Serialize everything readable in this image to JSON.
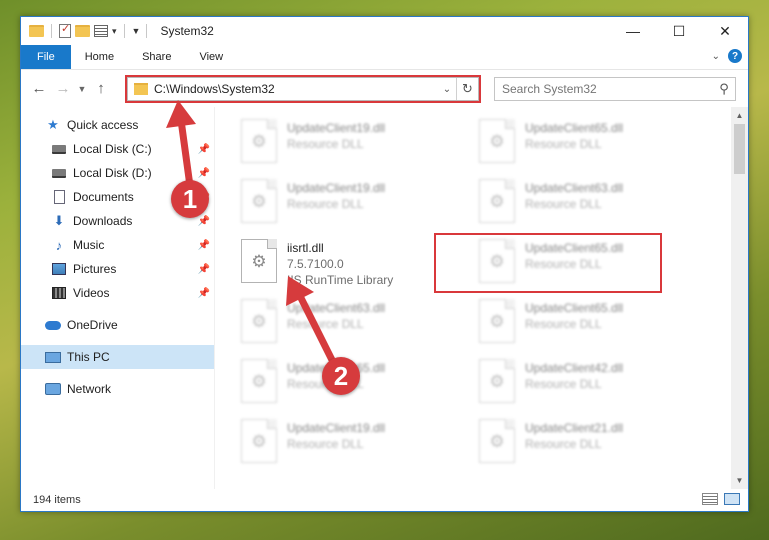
{
  "window": {
    "title": "System32",
    "controls": {
      "minimize": "—",
      "maximize": "☐",
      "close": "✕"
    }
  },
  "ribbon": {
    "tabs": [
      {
        "label": "File"
      },
      {
        "label": "Share"
      },
      {
        "label": "View"
      }
    ],
    "home_label": "Home"
  },
  "nav": {
    "address_path": "C:\\Windows\\System32",
    "search_placeholder": "Search System32"
  },
  "sidebar": {
    "items": [
      {
        "label": "Quick access",
        "icon": "star-icon"
      },
      {
        "label": "Local Disk (C:)",
        "icon": "disk-icon",
        "pinned": true
      },
      {
        "label": "Local Disk (D:)",
        "icon": "disk-icon",
        "pinned": true
      },
      {
        "label": "Documents",
        "icon": "documents-icon",
        "pinned": true
      },
      {
        "label": "Downloads",
        "icon": "downloads-icon",
        "pinned": true
      },
      {
        "label": "Music",
        "icon": "music-icon",
        "pinned": true
      },
      {
        "label": "Pictures",
        "icon": "pictures-icon",
        "pinned": true
      },
      {
        "label": "Videos",
        "icon": "videos-icon",
        "pinned": true
      },
      {
        "label": "OneDrive",
        "icon": "onedrive-icon"
      },
      {
        "label": "This PC",
        "icon": "pc-icon",
        "selected": true
      },
      {
        "label": "Network",
        "icon": "network-icon"
      }
    ]
  },
  "files": [
    {
      "name": "UpdateClient19.dll",
      "type": "Resource DLL"
    },
    {
      "name": "UpdateClient65.dll",
      "type": "Resource DLL"
    },
    {
      "name": "UpdateClient19.dll",
      "type": "Resource DLL"
    },
    {
      "name": "UpdateClient63.dll",
      "type": "Resource DLL"
    },
    {
      "name": "iisrtl.dll",
      "version": "7.5.7100.0",
      "type": "IIS RunTime Library",
      "highlighted": true
    },
    {
      "name": "UpdateClient65.dll",
      "type": "Resource DLL"
    },
    {
      "name": "UpdateClient63.dll",
      "type": "Resource DLL"
    },
    {
      "name": "UpdateClient65.dll",
      "type": "Resource DLL"
    },
    {
      "name": "UpdateClient65.dll",
      "type": "Resource DLL"
    },
    {
      "name": "UpdateClient42.dll",
      "type": "Resource DLL"
    },
    {
      "name": "UpdateClient19.dll",
      "type": "Resource DLL"
    },
    {
      "name": "UpdateClient21.dll",
      "type": "Resource DLL"
    }
  ],
  "status": {
    "item_count": "194 items"
  },
  "callouts": {
    "step1": "1",
    "step2": "2",
    "color": "#d63b3d"
  }
}
